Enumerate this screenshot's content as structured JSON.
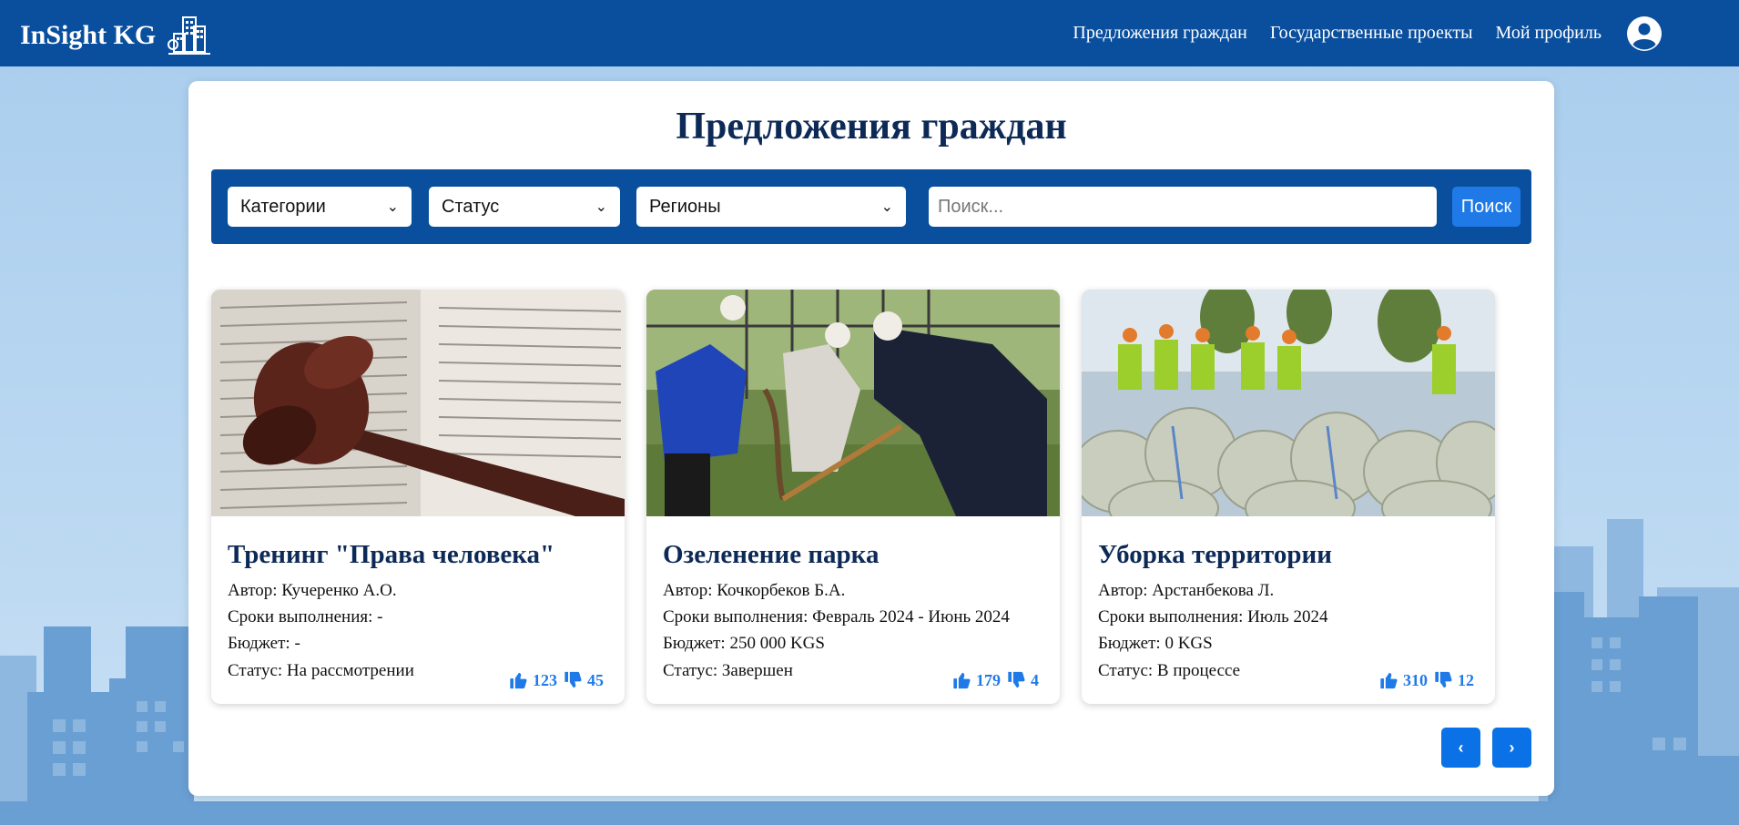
{
  "header": {
    "brand": "InSight KG",
    "nav": [
      "Предложения граждан",
      "Государственные проекты",
      "Мой профиль"
    ]
  },
  "main": {
    "title": "Предложения граждан",
    "filters": {
      "category": "Категории",
      "status": "Статус",
      "region": "Регионы",
      "search_placeholder": "Поиск...",
      "search_button": "Поиск"
    },
    "cards": [
      {
        "image": "gavel-on-book-photo",
        "title": "Тренинг \"Права человека\"",
        "author": "Автор: Кучеренко А.О.",
        "deadline": "Сроки выполнения: -",
        "budget": "Бюджет: -",
        "status": "Статус: На рассмотрении",
        "likes": "123",
        "dislikes": "45"
      },
      {
        "image": "tree-planting-photo",
        "title": "Озеленение парка",
        "author": "Автор: Кочкорбеков Б.А.",
        "deadline": "Сроки выполнения: Февраль 2024 - Июнь 2024",
        "budget": "Бюджет: 250 000 KGS",
        "status": "Статус: Завершен",
        "likes": "179",
        "dislikes": "4"
      },
      {
        "image": "cleanup-bags-photo",
        "title": "Уборка территории",
        "author": "Автор: Арстанбекова Л.",
        "deadline": "Сроки выполнения: Июль 2024",
        "budget": "Бюджет: 0 KGS",
        "status": "Статус: В процессе",
        "likes": "310",
        "dislikes": "12"
      }
    ],
    "pagination": {
      "prev": "‹",
      "next": "›"
    }
  },
  "colors": {
    "header_bg": "#0a4f9e",
    "accent": "#1f7ae8",
    "title": "#0d2a57"
  }
}
